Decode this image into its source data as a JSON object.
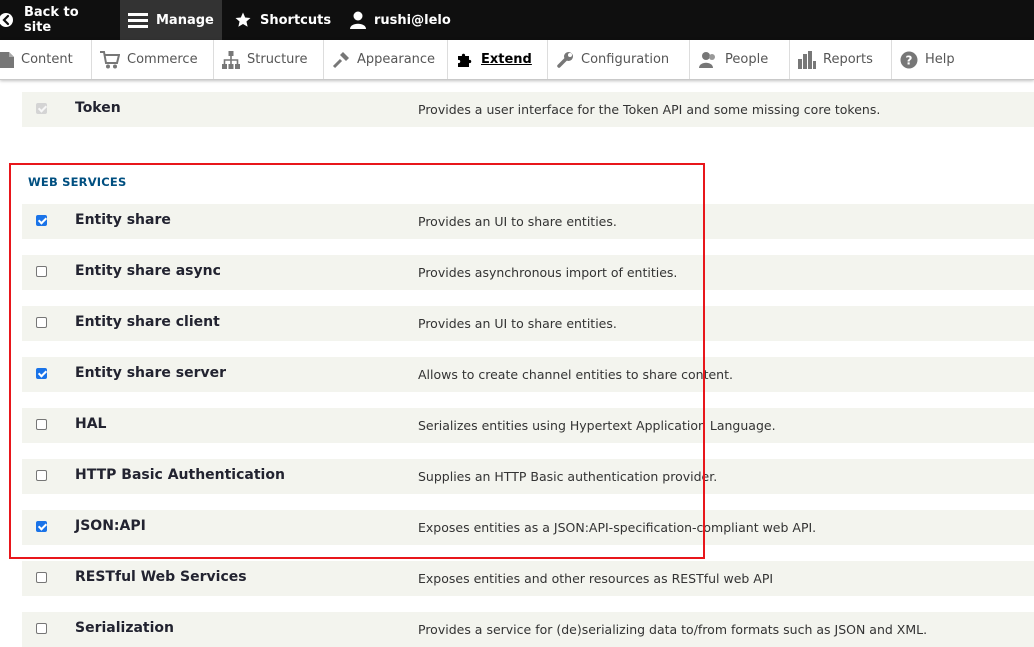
{
  "toolbar": {
    "back_label": "Back to site",
    "manage_label": "Manage",
    "shortcuts_label": "Shortcuts",
    "user_label": "rushi@lelo"
  },
  "tray": {
    "items": [
      {
        "label": "Content",
        "icon": "page-icon"
      },
      {
        "label": "Commerce",
        "icon": "cart-icon"
      },
      {
        "label": "Structure",
        "icon": "structure-icon"
      },
      {
        "label": "Appearance",
        "icon": "brush-icon"
      },
      {
        "label": "Extend",
        "icon": "puzzle-icon"
      },
      {
        "label": "Configuration",
        "icon": "wrench-icon"
      },
      {
        "label": "People",
        "icon": "people-icon"
      },
      {
        "label": "Reports",
        "icon": "bar-chart-icon"
      },
      {
        "label": "Help",
        "icon": "help-icon"
      }
    ],
    "active": "Extend"
  },
  "modules": {
    "token": {
      "name": "Token",
      "description": "Provides a user interface for the Token API and some missing core tokens.",
      "checked": true,
      "disabled": true
    },
    "section_title": "WEB SERVICES",
    "items": [
      {
        "name": "Entity share",
        "description": "Provides an UI to share entities.",
        "checked": true
      },
      {
        "name": "Entity share async",
        "description": "Provides asynchronous import of entities.",
        "checked": false
      },
      {
        "name": "Entity share client",
        "description": "Provides an UI to share entities.",
        "checked": false
      },
      {
        "name": "Entity share server",
        "description": "Allows to create channel entities to share content.",
        "checked": true
      },
      {
        "name": "HAL",
        "description": "Serializes entities using Hypertext Application Language.",
        "checked": false
      },
      {
        "name": "HTTP Basic Authentication",
        "description": "Supplies an HTTP Basic authentication provider.",
        "checked": false
      },
      {
        "name": "JSON:API",
        "description": "Exposes entities as a JSON:API-specification-compliant web API.",
        "checked": true
      },
      {
        "name": "RESTful Web Services",
        "description": "Exposes entities and other resources as RESTful web API",
        "checked": false
      },
      {
        "name": "Serialization",
        "description": "Provides a service for (de)serializing data to/from formats such as JSON and XML.",
        "checked": false
      }
    ]
  },
  "colors": {
    "toolbar_bg": "#0f0f0f",
    "manage_bg": "#333333",
    "row_bg": "#f3f4ee",
    "section_title": "#004f80",
    "checkbox_checked": "#1a73e8",
    "highlight_border": "#e8161b"
  }
}
